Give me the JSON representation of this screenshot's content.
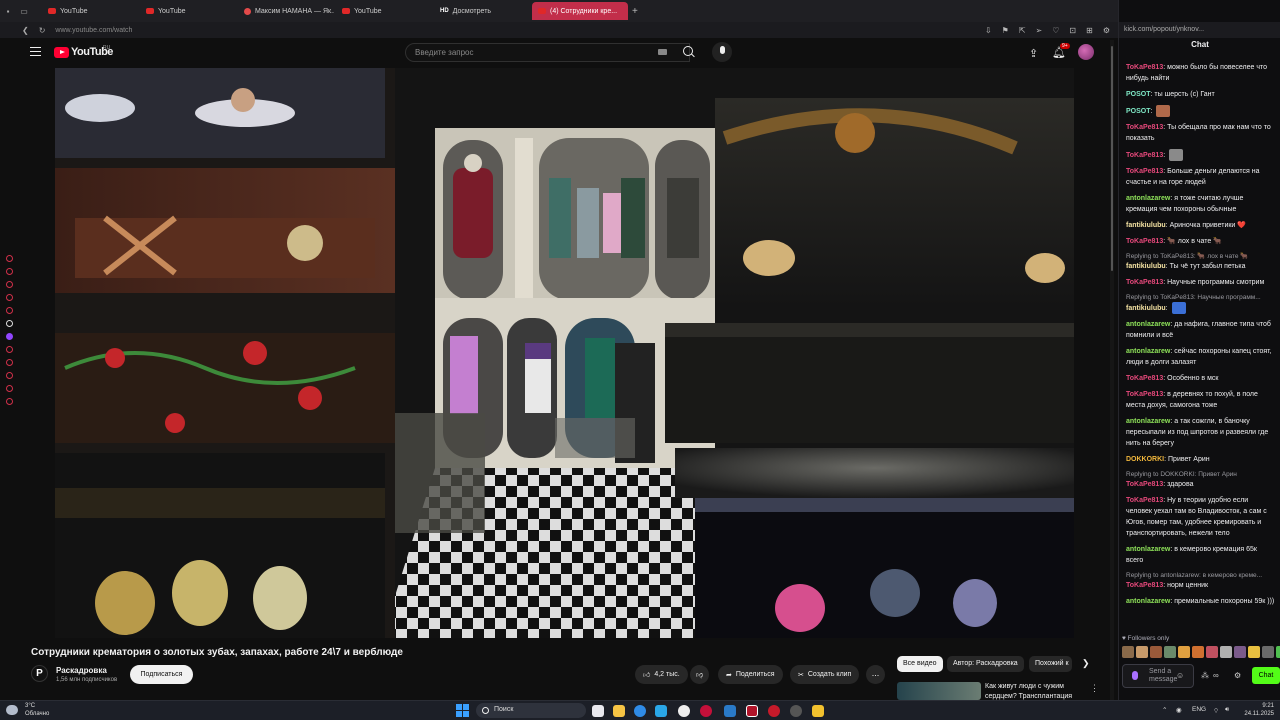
{
  "browser": {
    "tabs": [
      {
        "label": "YouTube",
        "kind": "yt",
        "active": false
      },
      {
        "label": "YouTube",
        "kind": "yt",
        "active": false
      },
      {
        "label": "Максим НАМАНА — Як...",
        "kind": "vk",
        "active": false
      },
      {
        "label": "YouTube",
        "kind": "yt",
        "active": false
      },
      {
        "label": "Досмотреть",
        "kind": "hd",
        "active": false
      },
      {
        "label": "(4) Сотрудники кре...",
        "kind": "yt",
        "active": true
      }
    ],
    "hd_badge": "HD",
    "url": "www.youtube.com/watch",
    "chat_url": "kick.com/popout/ynknov..."
  },
  "youtube": {
    "logo_text": "YouTube",
    "region": "RU",
    "search_placeholder": "Введите запрос",
    "notifications_count": "9+",
    "video_title": "Сотрудники крематория о золотых зубах, запахах, работе 24\\7 и верблюде",
    "channel": {
      "name": "Раскадровка",
      "subscribers": "1,56 млн подписчиков",
      "avatar_letter": "P"
    },
    "subscribe_label": "Подписаться",
    "likes": "4,2 тыс.",
    "share_label": "Поделиться",
    "clip_label": "Создать клип",
    "more_label": "...",
    "chips": [
      "Все видео",
      "Автор: Раскадровка",
      "Похожий к"
    ],
    "recommended_title": "Как живут люди с чужим сердцем? Трансплантация"
  },
  "chat": {
    "header": "Chat",
    "messages": [
      {
        "reply": "",
        "user": "ToKaPe813",
        "color": "#e4487a",
        "text": "можно было бы повеселее что нибудь найти"
      },
      {
        "reply": "",
        "user": "POSOT",
        "color": "#7fe8c6",
        "text": "ты шерсть (c) Гант"
      },
      {
        "reply": "",
        "user": "POSOT",
        "color": "#7fe8c6",
        "text": "",
        "emote": "#b0694a"
      },
      {
        "reply": "",
        "user": "ToKaPe813",
        "color": "#e4487a",
        "text": "Ты обещала про мак нам что то показать"
      },
      {
        "reply": "",
        "user": "ToKaPe813",
        "color": "#e4487a",
        "text": "",
        "emote": "#8a8a8a"
      },
      {
        "reply": "",
        "user": "ToKaPe813",
        "color": "#e4487a",
        "text": "Больше деньги делаются на счастье и на горе людей"
      },
      {
        "reply": "",
        "user": "antonlazarew",
        "color": "#8fe35a",
        "text": "я тоже считаю лучше кремация чем похороны обычные"
      },
      {
        "reply": "",
        "user": "fantikiulubu",
        "color": "#f5e3a3",
        "text": "Ариночка приветики ❤️"
      },
      {
        "reply": "",
        "user": "ToKaPe813",
        "color": "#e4487a",
        "text": "🐂 лох в чате 🐂"
      },
      {
        "reply": "Replying to ToKaPe813: 🐂 лох в чате 🐂",
        "user": "fantikiulubu",
        "color": "#f5e3a3",
        "text": "Ты чё тут забыл петька"
      },
      {
        "reply": "",
        "user": "ToKaPe813",
        "color": "#e4487a",
        "text": "Научные программы смотрим"
      },
      {
        "reply": "Replying to ToKaPe813: Научные программ...",
        "user": "fantikiulubu",
        "color": "#f5e3a3",
        "text": "",
        "emote": "#3b6fd6"
      },
      {
        "reply": "",
        "user": "antonlazarew",
        "color": "#8fe35a",
        "text": "да нафига, главное типа чтоб помнили и всё"
      },
      {
        "reply": "",
        "user": "antonlazarew",
        "color": "#8fe35a",
        "text": "сейчас похороны капец стоят, люди в долги залазят"
      },
      {
        "reply": "",
        "user": "ToKaPe813",
        "color": "#e4487a",
        "text": "Особенно в мск"
      },
      {
        "reply": "",
        "user": "ToKaPe813",
        "color": "#e4487a",
        "text": "в деревнях то похуй, в поле места дохуя, самогона тоже"
      },
      {
        "reply": "",
        "user": "antonlazarew",
        "color": "#8fe35a",
        "text": "а так сожгли, в баночку пересыпали из под шпротов и развеяли где нить на берегу"
      },
      {
        "reply": "",
        "user": "DOKKORKI",
        "color": "#f0b63c",
        "text": "Привет Арин"
      },
      {
        "reply": "Replying to DOKKORKI: Привет Арин",
        "user": "ToKaPe813",
        "color": "#e4487a",
        "text": "здарова"
      },
      {
        "reply": "",
        "user": "ToKaPe813",
        "color": "#e4487a",
        "text": "Ну в теории удобно если человек уехал там во Владивосток, а сам с Югов, помер там, удобнее кремировать и транспортировать, нежели тело"
      },
      {
        "reply": "",
        "user": "antonlazarew",
        "color": "#8fe35a",
        "text": "в кемерово кремация 65к всего"
      },
      {
        "reply": "Replying to antonlazarew: в кемерово креме...",
        "user": "ToKaPe813",
        "color": "#e4487a",
        "text": "норм ценник"
      },
      {
        "reply": "",
        "user": "antonlazarew",
        "color": "#8fe35a",
        "text": "премиальные похороны 59к )))"
      }
    ],
    "followers_only": "Followers only",
    "input_placeholder": "Send a message",
    "send_label": "Chat",
    "emote_colors": [
      "#8a6a4a",
      "#c79a6a",
      "#9a5a3a",
      "#6a8a6a",
      "#e0a040",
      "#d07030",
      "#c05060",
      "#b0b0b0",
      "#7a5a8a",
      "#e8c040",
      "#6a6a6a",
      "#50c050",
      "#a8a8a8"
    ]
  },
  "taskbar": {
    "temperature": "3°C",
    "weather": "Облачно",
    "search_label": "Поиск",
    "language": "ENG",
    "time": "9:21",
    "date": "24.11.2025"
  }
}
